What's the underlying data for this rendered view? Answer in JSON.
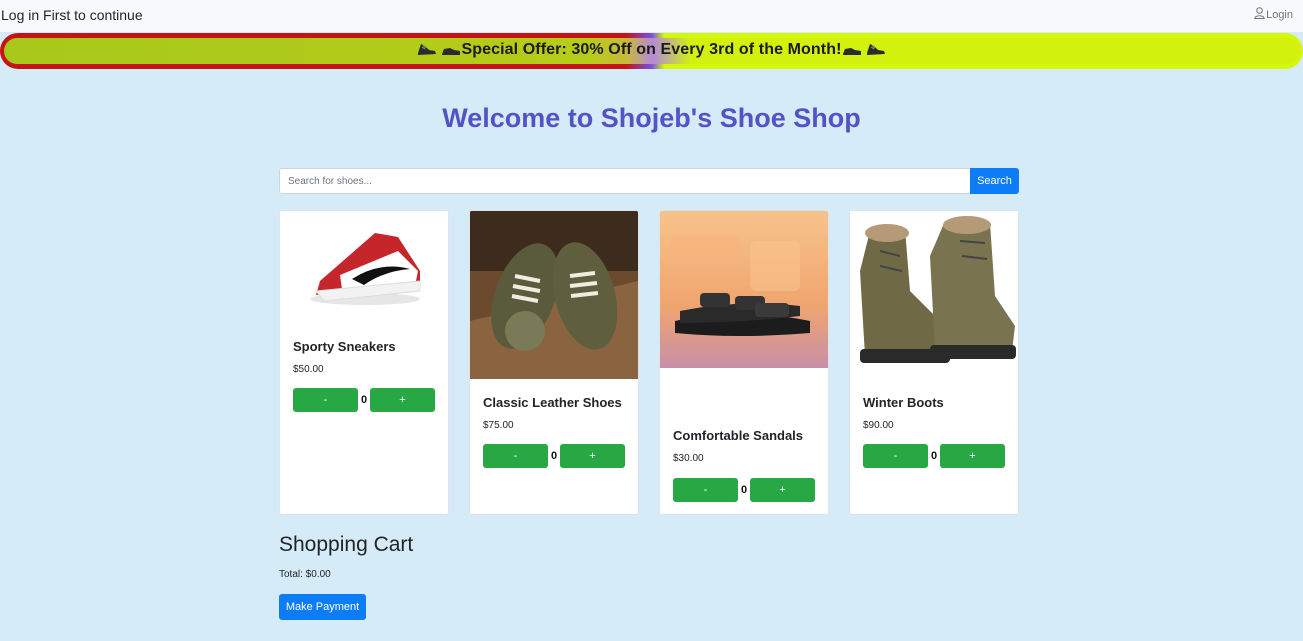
{
  "topbar": {
    "message": "Log in First to continue",
    "login_label": "Login",
    "login_icon": "user-icon"
  },
  "banner": {
    "text": "Special Offer: 30% Off on Every 3rd of the Month!",
    "icons": [
      "sneaker-icon",
      "shoe-icon"
    ],
    "colors": {
      "left": "#c41414",
      "right": "#d4f70c"
    }
  },
  "page": {
    "title": "Welcome to Shojeb's Shoe Shop",
    "title_color": "#5353c6",
    "background": "#d6ebf8"
  },
  "search": {
    "placeholder": "Search for shoes...",
    "button_label": "Search"
  },
  "products": [
    {
      "name": "Sporty Sneakers",
      "price": "$50.00",
      "quantity": "0",
      "minus": "-",
      "plus": "+"
    },
    {
      "name": "Classic Leather Shoes",
      "price": "$75.00",
      "quantity": "0",
      "minus": "-",
      "plus": "+"
    },
    {
      "name": "Comfortable Sandals",
      "price": "$30.00",
      "quantity": "0",
      "minus": "-",
      "plus": "+"
    },
    {
      "name": "Winter Boots",
      "price": "$90.00",
      "quantity": "0",
      "minus": "-",
      "plus": "+"
    }
  ],
  "cart": {
    "title": "Shopping Cart",
    "total": "Total: $0.00",
    "pay_label": "Make Payment"
  },
  "colors": {
    "primary": "#0d7df7",
    "success": "#28a745"
  }
}
